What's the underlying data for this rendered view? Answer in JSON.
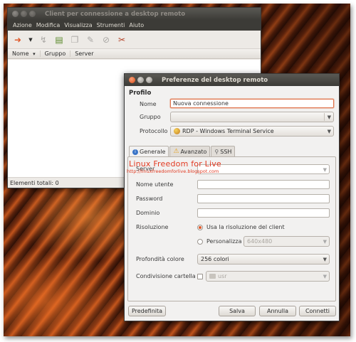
{
  "main_window": {
    "title": "Client per connessione a desktop remoto",
    "menu": [
      "Azione",
      "Modifica",
      "Visualizza",
      "Strumenti",
      "Aiuto"
    ],
    "columns": [
      "Nome",
      "Gruppo",
      "Server"
    ],
    "sort_indicator": "▾",
    "status": "Elementi totali: 0"
  },
  "prefs": {
    "title": "Preferenze del desktop remoto",
    "section": "Profilo",
    "nome_label": "Nome",
    "nome_value": "Nuova connessione",
    "gruppo_label": "Gruppo",
    "gruppo_value": "",
    "protocollo_label": "Protocollo",
    "protocollo_value": "RDP - Windows Terminal Service",
    "tabs": [
      "Generale",
      "Avanzato",
      "SSH"
    ],
    "server_label": "Server",
    "utente_label": "Nome utente",
    "password_label": "Password",
    "dominio_label": "Dominio",
    "risoluzione_label": "Risoluzione",
    "risoluzione_client": "Usa la risoluzione del client",
    "personalizza_label": "Personalizza",
    "personalizza_value": "640x480",
    "profondita_label": "Profondità colore",
    "profondita_value": "256 colori",
    "condivisione_label": "Condivisione cartella",
    "condivisione_value": "usr",
    "buttons": {
      "predefinita": "Predefinita",
      "salva": "Salva",
      "annulla": "Annulla",
      "connetti": "Connetti"
    }
  },
  "watermark": {
    "title": "Linux Freedom for Live",
    "url": "http://linuxfreedomforlive.blogspot.com"
  }
}
